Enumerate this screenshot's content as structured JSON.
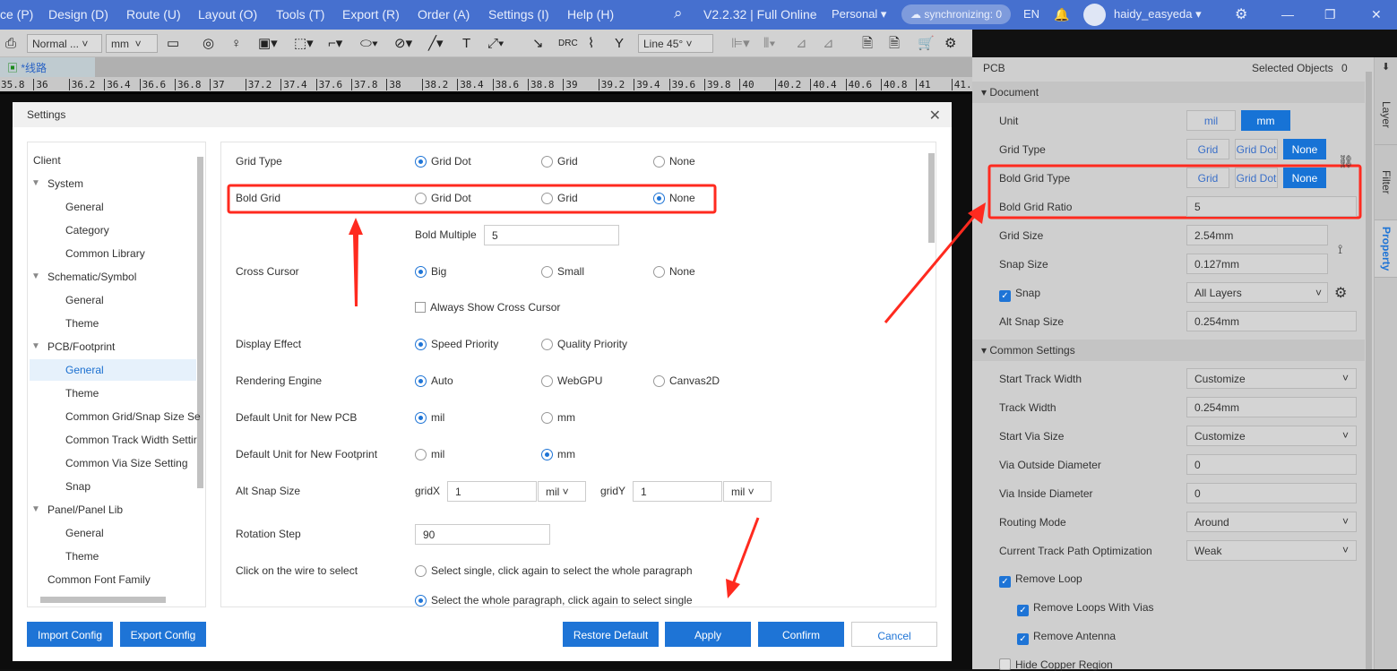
{
  "menu": [
    "ce (P)",
    "Design (D)",
    "Route (U)",
    "Layout (O)",
    "Tools (T)",
    "Export (R)",
    "Order (A)",
    "Settings (I)",
    "Help (H)"
  ],
  "topbar": {
    "version": "V2.2.32 | Full Online",
    "plan": "Personal",
    "sync": "synchronizing: 0",
    "lang": "EN",
    "user": "haidy_easyeda"
  },
  "toolbar": {
    "mode": "Normal ...",
    "unit": "mm",
    "route_mode": "Line 45°",
    "drc": "DRC"
  },
  "doc_tab": "*线路",
  "ruler": [
    "35.8",
    "36",
    "36.2",
    "36.4",
    "36.6",
    "36.8",
    "37",
    "37.2",
    "37.4",
    "37.6",
    "37.8",
    "38",
    "38.2",
    "38.4",
    "38.6",
    "38.8",
    "39",
    "39.2",
    "39.4",
    "39.6",
    "39.8",
    "40",
    "40.2",
    "40.4",
    "40.6",
    "40.8",
    "41",
    "41."
  ],
  "dialog": {
    "title": "Settings",
    "tree": [
      {
        "label": "Client",
        "level": 0
      },
      {
        "label": "System",
        "level": 1
      },
      {
        "label": "General",
        "level": 2
      },
      {
        "label": "Category",
        "level": 2
      },
      {
        "label": "Common Library",
        "level": 2
      },
      {
        "label": "Schematic/Symbol",
        "level": 1
      },
      {
        "label": "General",
        "level": 2
      },
      {
        "label": "Theme",
        "level": 2
      },
      {
        "label": "PCB/Footprint",
        "level": 1
      },
      {
        "label": "General",
        "level": 2,
        "selected": true
      },
      {
        "label": "Theme",
        "level": 2
      },
      {
        "label": "Common Grid/Snap Size Se",
        "level": 2
      },
      {
        "label": "Common Track Width Settir",
        "level": 2
      },
      {
        "label": "Common Via Size Setting",
        "level": 2
      },
      {
        "label": "Snap",
        "level": 2
      },
      {
        "label": "Panel/Panel Lib",
        "level": 1
      },
      {
        "label": "General",
        "level": 2
      },
      {
        "label": "Theme",
        "level": 2
      },
      {
        "label": "Common Font Family",
        "level": 0.5
      }
    ],
    "rows": [
      {
        "label": "Grid Type",
        "options": [
          "Grid Dot",
          "Grid",
          "None"
        ],
        "selected": 0
      },
      {
        "label": "Bold Grid",
        "options": [
          "Grid Dot",
          "Grid",
          "None"
        ],
        "selected": 2
      },
      {
        "label": "",
        "field_label": "Bold Multiple",
        "value": "5"
      },
      {
        "label": "Cross Cursor",
        "options": [
          "Big",
          "Small",
          "None"
        ],
        "selected": 0
      },
      {
        "label": "",
        "checkbox": "Always Show Cross Cursor",
        "checked": false
      },
      {
        "label": "Display Effect",
        "options": [
          "Speed Priority",
          "Quality Priority"
        ],
        "selected": 0
      },
      {
        "label": "Rendering Engine",
        "options": [
          "Auto",
          "WebGPU",
          "Canvas2D"
        ],
        "selected": 0
      },
      {
        "label": "Default Unit for New PCB",
        "options": [
          "mil",
          "mm"
        ],
        "selected": 0
      },
      {
        "label": "Default Unit for New Footprint",
        "options": [
          "mil",
          "mm"
        ],
        "selected": 1
      },
      {
        "label": "Alt Snap Size",
        "gridx_label": "gridX",
        "gridx": "1",
        "gridx_unit": "mil",
        "gridy_label": "gridY",
        "gridy": "1",
        "gridy_unit": "mil"
      },
      {
        "label": "Rotation Step",
        "value": "90"
      },
      {
        "label": "Click on the wire to select",
        "options": [
          "Select single, click again to select the whole paragraph"
        ],
        "selected": -1
      },
      {
        "label": "",
        "options": [
          "Select the whole paragraph, click again to select single"
        ],
        "selected": 0
      }
    ],
    "buttons": {
      "import": "Import Config",
      "export": "Export Config",
      "restore": "Restore Default",
      "apply": "Apply",
      "confirm": "Confirm",
      "cancel": "Cancel"
    }
  },
  "panel": {
    "title": "PCB",
    "selected_label": "Selected Objects",
    "selected_count": "0",
    "document": "Document",
    "unit": {
      "label": "Unit",
      "options": [
        "mil",
        "mm"
      ],
      "selected": 1
    },
    "grid_type": {
      "label": "Grid Type",
      "options": [
        "Grid",
        "Grid Dot",
        "None"
      ],
      "selected": 2
    },
    "bold_grid_type": {
      "label": "Bold Grid Type",
      "options": [
        "Grid",
        "Grid Dot",
        "None"
      ],
      "selected": 2
    },
    "bold_grid_ratio": {
      "label": "Bold Grid Ratio",
      "value": "5"
    },
    "grid_size": {
      "label": "Grid Size",
      "value": "2.54mm"
    },
    "snap_size": {
      "label": "Snap Size",
      "value": "0.127mm"
    },
    "snap": {
      "label": "Snap",
      "checked": true,
      "value": "All Layers"
    },
    "alt_snap": {
      "label": "Alt Snap Size",
      "value": "0.254mm"
    },
    "common": "Common Settings",
    "common_rows": [
      {
        "label": "Start Track Width",
        "value": "Customize",
        "dropdown": true
      },
      {
        "label": "Track Width",
        "value": "0.254mm"
      },
      {
        "label": "Start Via Size",
        "value": "Customize",
        "dropdown": true
      },
      {
        "label": "Via Outside Diameter",
        "value": "0"
      },
      {
        "label": "Via Inside Diameter",
        "value": "0"
      },
      {
        "label": "Routing Mode",
        "value": "Around",
        "dropdown": true
      },
      {
        "label": "Current Track Path Optimization",
        "value": "Weak",
        "dropdown": true
      }
    ],
    "checks": [
      {
        "label": "Remove Loop",
        "checked": true,
        "indent": false
      },
      {
        "label": "Remove Loops With Vias",
        "checked": true,
        "indent": true
      },
      {
        "label": "Remove Antenna",
        "checked": true,
        "indent": true
      },
      {
        "label": "Hide Copper Region",
        "checked": false,
        "indent": false
      }
    ],
    "tabs": [
      "Layer",
      "Filter",
      "Property"
    ],
    "active_tab": 2
  },
  "colors": {
    "accent": "#1e74d6",
    "topbar": "#4670cf",
    "annotation": "#ff2a1f"
  }
}
